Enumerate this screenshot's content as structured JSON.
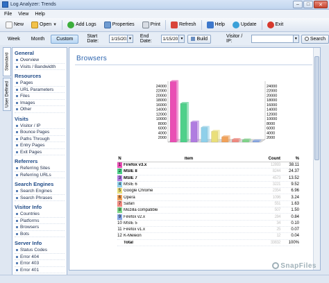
{
  "window": {
    "title": "Log Analyzer: Trends"
  },
  "menu": [
    "File",
    "View",
    "Help"
  ],
  "toolbar": {
    "new": "New",
    "open": "Open",
    "add_logs": "Add Logs",
    "properties": "Properties",
    "print": "Print",
    "refresh": "Refresh",
    "help": "Help",
    "update": "Update",
    "exit": "Exit"
  },
  "filters": {
    "week": "Week",
    "month": "Month",
    "custom": "Custom",
    "start_label": "Start Date:",
    "start_value": "1/15/2010",
    "end_label": "End Date:",
    "end_value": "1/15/2010",
    "build": "Build",
    "visitor_label": "Visitor / IP:",
    "search": "Search"
  },
  "vtabs": [
    "Standard",
    "User Defined"
  ],
  "sidebar": [
    {
      "title": "General",
      "items": [
        "Overview",
        "Visits / Bandwidth"
      ]
    },
    {
      "title": "Resources",
      "items": [
        "Pages",
        "URL Parameters",
        "Files",
        "Images",
        "Other"
      ]
    },
    {
      "title": "Visits",
      "items": [
        "Visitor / IP",
        "Bounce Pages",
        "Paths Through",
        "Entry Pages",
        "Exit Pages"
      ]
    },
    {
      "title": "Referrers",
      "items": [
        "Referring Sites",
        "Referring URLs"
      ]
    },
    {
      "title": "Search Engines",
      "items": [
        "Search Engines",
        "Search Phrases"
      ]
    },
    {
      "title": "Visitor Info",
      "items": [
        "Countries",
        "Platforms",
        "Browsers",
        "Bots"
      ]
    },
    {
      "title": "Server Info",
      "items": [
        "Status Codes",
        "Error 404",
        "Error 403",
        "Error 401"
      ]
    }
  ],
  "main": {
    "title": "Browsers",
    "table_head": {
      "n": "N",
      "item": "Item",
      "count": "Count",
      "pct": "%"
    }
  },
  "rows": [
    {
      "n": "1",
      "item": "Firefox v3.x",
      "count": "12893",
      "pct": "38.11",
      "color": "#e94fb4",
      "bold": true
    },
    {
      "n": "2",
      "item": "MSIE 8",
      "count": "8244",
      "pct": "24.37",
      "color": "#4fd08a",
      "bold": true
    },
    {
      "n": "3",
      "item": "MSIE 7",
      "count": "4573",
      "pct": "13.52",
      "color": "#b07ce0",
      "bold": true
    },
    {
      "n": "4",
      "item": "MSIE 6",
      "count": "3221",
      "pct": "9.52",
      "color": "#8fd0ea",
      "bold": false
    },
    {
      "n": "5",
      "item": "Google Chrome",
      "count": "2354",
      "pct": "6.96",
      "color": "#eadf7a",
      "bold": false
    },
    {
      "n": "6",
      "item": "Opera",
      "count": "1096",
      "pct": "3.24",
      "color": "#f2a25a",
      "bold": false
    },
    {
      "n": "7",
      "item": "Safari",
      "count": "551",
      "pct": "1.63",
      "color": "#f08a80",
      "bold": false
    },
    {
      "n": "8",
      "item": "Mozilla compatible",
      "count": "507",
      "pct": "1.50",
      "color": "#7fd68a",
      "bold": false
    },
    {
      "n": "9",
      "item": "Firefox v2.x",
      "count": "284",
      "pct": "0.84",
      "color": "#88a8e6",
      "bold": false
    },
    {
      "n": "10",
      "item": "MSIE 5",
      "count": "34",
      "pct": "0.10",
      "color": "",
      "bold": false
    },
    {
      "n": "11",
      "item": "Firefox v1.x",
      "count": "25",
      "pct": "0.07",
      "color": "",
      "bold": false
    },
    {
      "n": "12",
      "item": "K-Meleon",
      "count": "12",
      "pct": "0.04",
      "color": "",
      "bold": false
    },
    {
      "n": "",
      "item": "Total",
      "count": "33832",
      "pct": "100%",
      "color": "",
      "bold": true
    }
  ],
  "chart_data": {
    "type": "bar",
    "categories": [
      "Firefox v3.x",
      "MSIE 8",
      "MSIE 7",
      "MSIE 6",
      "Google Chrome",
      "Opera",
      "Safari",
      "Mozilla compatible",
      "Firefox v2.x"
    ],
    "values": [
      25800,
      16500,
      8600,
      6300,
      4600,
      2300,
      1200,
      1000,
      600
    ],
    "colors": [
      "#e94fb4",
      "#4fd08a",
      "#b07ce0",
      "#8fd0ea",
      "#eadf7a",
      "#f2a25a",
      "#f08a80",
      "#7fd68a",
      "#88a8e6"
    ],
    "ylim": [
      0,
      26000
    ],
    "yticks": [
      "24000",
      "22000",
      "20000",
      "18000",
      "16000",
      "14000",
      "12000",
      "10000",
      "8000",
      "6000",
      "4000",
      "2000"
    ],
    "grid": false
  },
  "watermark": "SnapFiles"
}
